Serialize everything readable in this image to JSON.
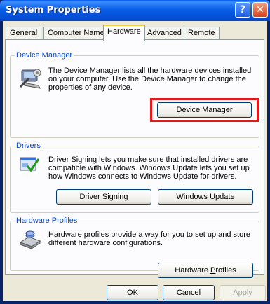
{
  "window": {
    "title": "System Properties",
    "help_glyph": "?",
    "close_glyph": "✕"
  },
  "tabs": [
    {
      "label": "General"
    },
    {
      "label": "Computer Name"
    },
    {
      "label": "Hardware",
      "active": true
    },
    {
      "label": "Advanced"
    },
    {
      "label": "Remote"
    }
  ],
  "device_manager": {
    "legend": "Device Manager",
    "description": "The Device Manager lists all the hardware devices installed on your computer. Use the Device Manager to change the properties of any device.",
    "button": {
      "pre": "",
      "mnemonic": "D",
      "post": "evice Manager"
    }
  },
  "drivers": {
    "legend": "Drivers",
    "description": "Driver Signing lets you make sure that installed drivers are compatible with Windows. Windows Update lets you set up how Windows connects to Windows Update for drivers.",
    "signing_button": {
      "pre": "Driver ",
      "mnemonic": "S",
      "post": "igning"
    },
    "update_button": {
      "pre": "",
      "mnemonic": "W",
      "post": "indows Update"
    }
  },
  "hardware_profiles": {
    "legend": "Hardware Profiles",
    "description": "Hardware profiles provide a way for you to set up and store different hardware configurations.",
    "button": {
      "pre": "Hardware ",
      "mnemonic": "P",
      "post": "rofiles"
    }
  },
  "footer": {
    "ok": "OK",
    "cancel": "Cancel",
    "apply": {
      "pre": "",
      "mnemonic": "A",
      "post": "pply"
    }
  },
  "colors": {
    "highlight": "#e31a1a",
    "legend": "#0046d5",
    "titlebar": "#0553dc"
  }
}
